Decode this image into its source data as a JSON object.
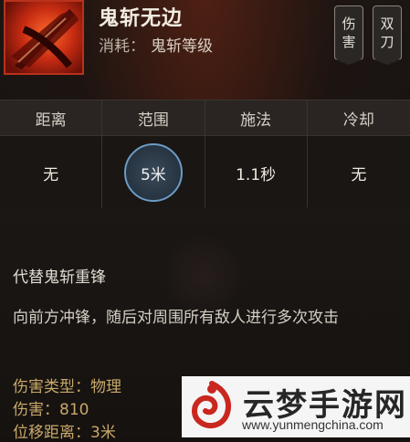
{
  "header": {
    "skill_name": "鬼斩无边",
    "cost_label": "消耗：",
    "cost_value": "鬼斩等级",
    "tags": [
      "伤害",
      "双刀"
    ]
  },
  "stats": {
    "labels": [
      "距离",
      "范围",
      "施法",
      "冷却"
    ],
    "values": [
      "无",
      "5米",
      "1.1秒",
      "无"
    ]
  },
  "description": {
    "replace_text": "代替鬼斩重锋",
    "effect_text": "向前方冲锋，随后对周围所有敌人进行多次攻击",
    "attributes": [
      {
        "label": "伤害类型：",
        "value": "物理"
      },
      {
        "label": "伤害：",
        "value": "810"
      },
      {
        "label": "位移距离：",
        "value": "3米"
      }
    ]
  },
  "watermark": {
    "title": "云梦手游网",
    "url": "www.yunmengchina.com"
  },
  "colors": {
    "accent_red": "#b8321c",
    "attribute_gold": "#c8a86a",
    "range_ring_blue": "#6c9bc4"
  },
  "icons": [
    "crossed-blades-skill-icon",
    "yunmeng-logo-icon"
  ]
}
